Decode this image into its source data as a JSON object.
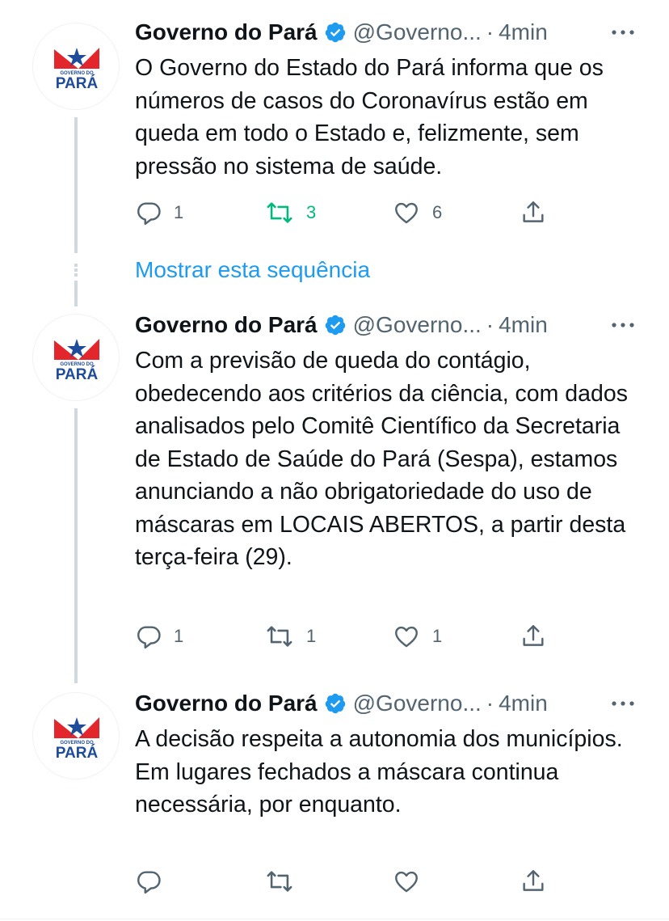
{
  "tweets": [
    {
      "name": "Governo do Pará",
      "handle": "@Governo...",
      "separator": "·",
      "time": "4min",
      "text": "O Governo do Estado do Pará informa que os números de casos do Coronavírus estão em queda em todo o Estado e, felizmente, sem pressão no sistema de saúde.",
      "replies": "1",
      "retweets": "3",
      "likes": "6",
      "retweeted": true
    },
    {
      "name": "Governo do Pará",
      "handle": "@Governo...",
      "separator": "·",
      "time": "4min",
      "text": "Com a previsão de queda do contágio, obedecendo aos critérios da ciência, com dados analisados pelo Comitê Científico da Secretaria de Estado de Saúde do Pará (Sespa), estamos anunciando a não obrigatoriedade do uso de máscaras em LOCAIS ABERTOS, a partir desta terça-feira (29).",
      "replies": "1",
      "retweets": "1",
      "likes": "1",
      "retweeted": false
    },
    {
      "name": "Governo do Pará",
      "handle": "@Governo...",
      "separator": "·",
      "time": "4min",
      "text": "A decisão respeita a autonomia dos municípios. Em lugares fechados a máscara continua necessária, por enquanto.",
      "replies": "",
      "retweets": "",
      "likes": "",
      "retweeted": false
    }
  ],
  "show_thread_label": "Mostrar esta sequência",
  "avatar": {
    "logo_text_small": "GOVERNO DO",
    "logo_text_big": "PARÁ"
  },
  "icons": {
    "reply": "reply-icon",
    "retweet": "retweet-icon",
    "like": "heart-icon",
    "share": "share-icon",
    "verified": "verified-badge-icon",
    "more": "more-icon"
  },
  "colors": {
    "text": "#0f1419",
    "secondary": "#536471",
    "accent": "#1d9bf0",
    "retweet_active": "#00ba7c",
    "thread_line": "#cfd9de",
    "logo_red": "#e3262c",
    "logo_blue": "#1e4c9a"
  }
}
